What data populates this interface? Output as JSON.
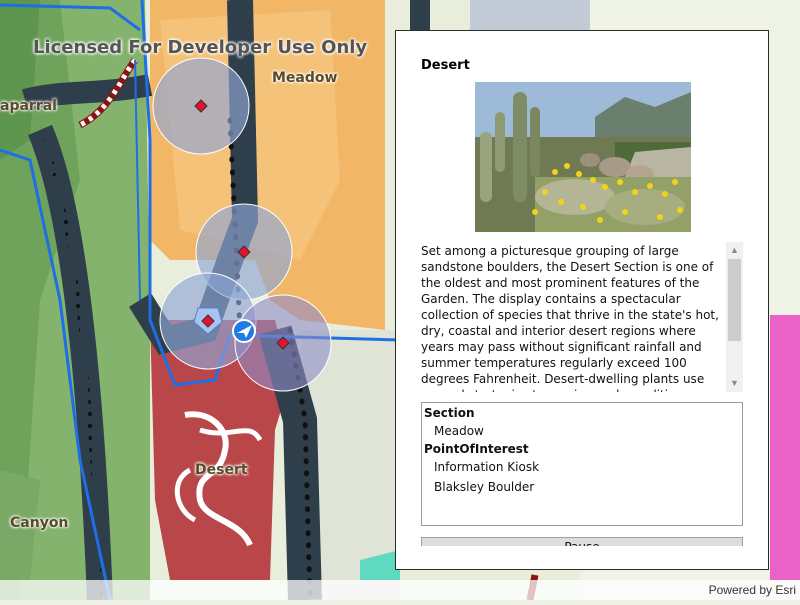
{
  "map": {
    "watermark": "Licensed For Developer Use Only",
    "labels": {
      "meadow": "Meadow",
      "chaparral": "aparral",
      "desert": "Desert",
      "canyon": "Canyon"
    },
    "attribution": "Powered by Esri",
    "colors": {
      "meadow": "#f2b766",
      "desert": "#b9474a",
      "grassland": "#7fb26a",
      "path": "#2e3f4b",
      "route": "#1e6ee6",
      "marker": "#e8112d",
      "buffer": "#8fa6d6"
    }
  },
  "callout": {
    "title": "Desert",
    "image_alt": "desert-garden-photo",
    "description": "Set among a picturesque grouping of large sandstone boulders, the Desert Section is one of the oldest and most prominent features of the Garden.  The display contains a spectacular collection of species that thrive in the state's hot, dry, coastal and interior desert regions where years may pass without significant rainfall and summer temperatures regularly exceed 100 degrees Fahrenheit.  Desert-dwelling plants use several strategies to survive such conditions. Members of the cactus family, of which are the ultimate succulents, their leaves have",
    "features": {
      "section_header": "Section",
      "section_items": [
        "Meadow"
      ],
      "poi_header": "PointOfInterest",
      "poi_items": [
        "Information Kiosk",
        "Blaksley Boulder"
      ]
    },
    "pause_label": "Pause"
  }
}
